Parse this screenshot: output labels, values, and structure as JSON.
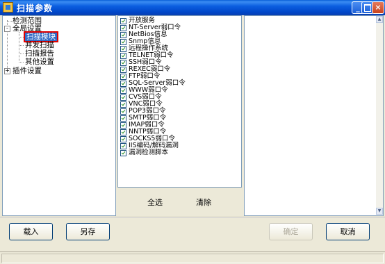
{
  "window": {
    "title": "扫描参数",
    "controls": {
      "minimize": "_",
      "close": "×"
    }
  },
  "tree": {
    "items": [
      {
        "label": "检测范围",
        "level": 0,
        "expander": ""
      },
      {
        "label": "全局设置",
        "level": 0,
        "expander": "-"
      },
      {
        "label": "扫描模块",
        "level": 1,
        "expander": "",
        "selected": true
      },
      {
        "label": "并发扫描",
        "level": 1,
        "expander": ""
      },
      {
        "label": "扫描报告",
        "level": 1,
        "expander": ""
      },
      {
        "label": "其他设置",
        "level": 1,
        "expander": ""
      },
      {
        "label": "插件设置",
        "level": 0,
        "expander": "+"
      }
    ]
  },
  "modules": {
    "items": [
      {
        "label": "开放服务",
        "checked": true
      },
      {
        "label": "NT-Server弱口令",
        "checked": true
      },
      {
        "label": "NetBios信息",
        "checked": true
      },
      {
        "label": "Snmp信息",
        "checked": true
      },
      {
        "label": "远程操作系统",
        "checked": true
      },
      {
        "label": "TELNET弱口令",
        "checked": true
      },
      {
        "label": "SSH弱口令",
        "checked": true
      },
      {
        "label": "REXEC弱口令",
        "checked": true
      },
      {
        "label": "FTP弱口令",
        "checked": true
      },
      {
        "label": "SQL-Server弱口令",
        "checked": true
      },
      {
        "label": "WWW弱口令",
        "checked": true
      },
      {
        "label": "CVS弱口令",
        "checked": true
      },
      {
        "label": "VNC弱口令",
        "checked": true
      },
      {
        "label": "POP3弱口令",
        "checked": true
      },
      {
        "label": "SMTP弱口令",
        "checked": true
      },
      {
        "label": "IMAP弱口令",
        "checked": true
      },
      {
        "label": "NNTP弱口令",
        "checked": true
      },
      {
        "label": "SOCKS5弱口令",
        "checked": true
      },
      {
        "label": "IIS编码/解码漏洞",
        "checked": true
      },
      {
        "label": "漏洞检测脚本",
        "checked": true
      }
    ],
    "select_all_label": "全选",
    "clear_label": "清除"
  },
  "buttons": {
    "load": "载入",
    "save_as": "另存",
    "ok": "确定",
    "cancel": "取消"
  }
}
